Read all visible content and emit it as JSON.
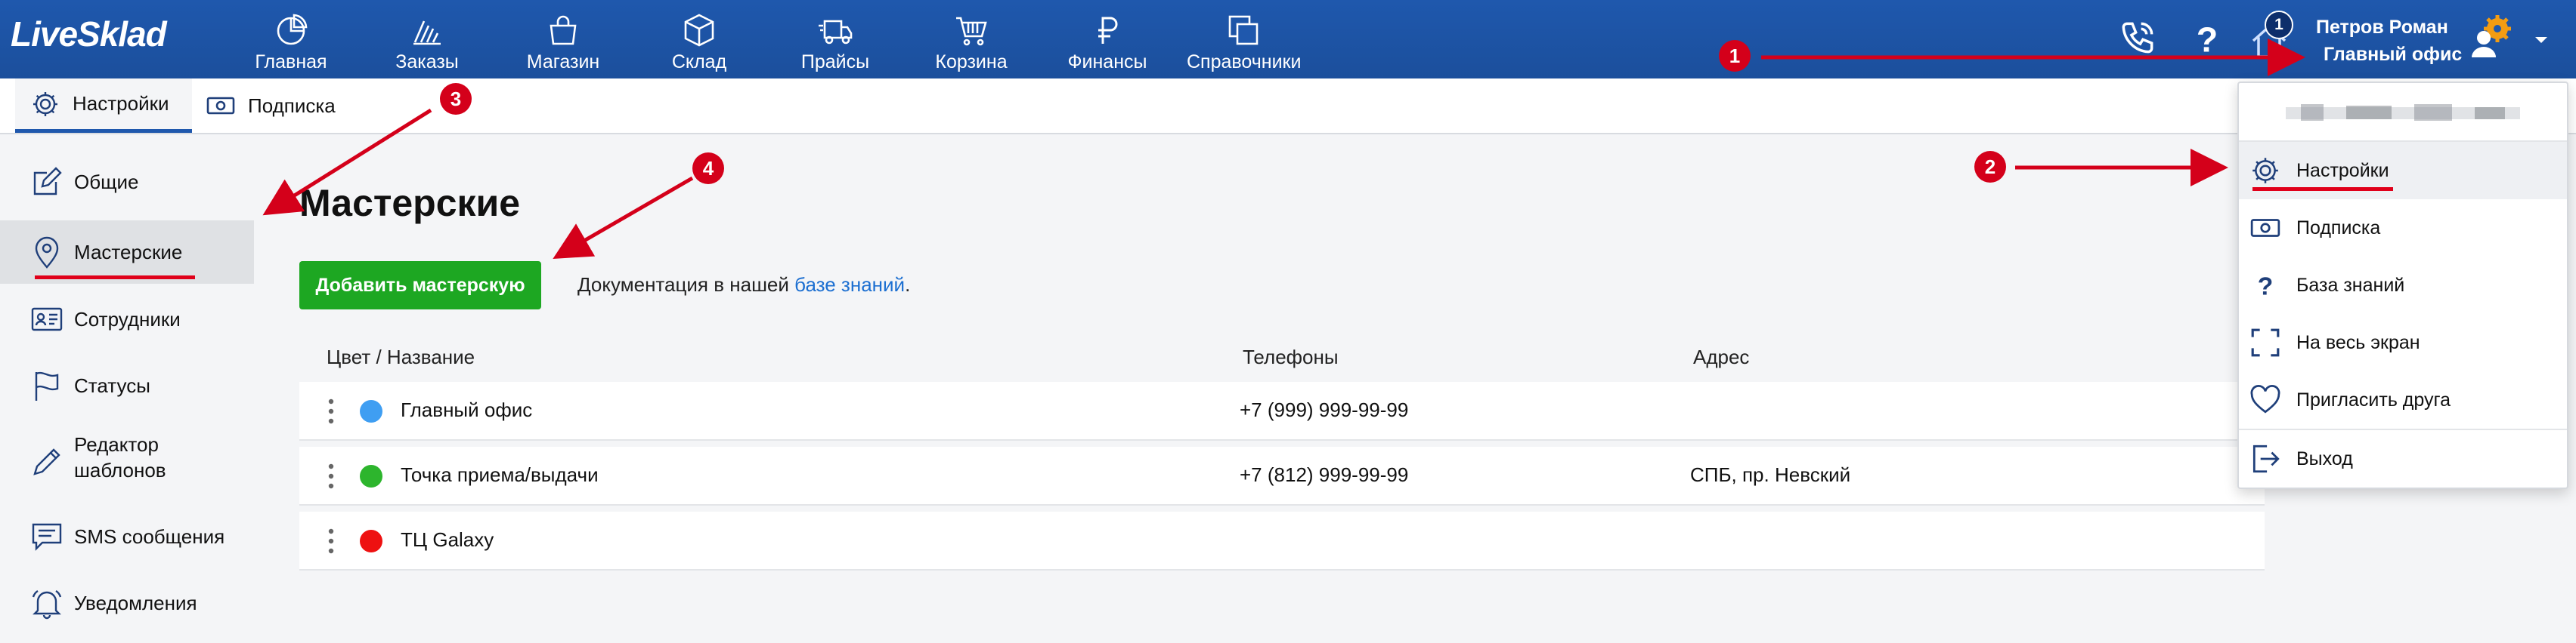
{
  "app": {
    "logo": "LiveSklad"
  },
  "nav": [
    {
      "label": "Главная",
      "icon": "chart-pie-icon"
    },
    {
      "label": "Заказы",
      "icon": "orders-icon"
    },
    {
      "label": "Магазин",
      "icon": "shopping-bag-icon"
    },
    {
      "label": "Склад",
      "icon": "box-icon"
    },
    {
      "label": "Прайсы",
      "icon": "truck-icon"
    },
    {
      "label": "Корзина",
      "icon": "cart-icon"
    },
    {
      "label": "Финансы",
      "icon": "ruble-icon"
    },
    {
      "label": "Справочники",
      "icon": "copy-icon"
    }
  ],
  "header": {
    "notification_count": "1",
    "user_name": "Петров Роман",
    "user_office": "Главный офис"
  },
  "subtabs": [
    {
      "label": "Настройки",
      "icon": "gear-icon",
      "active": true
    },
    {
      "label": "Подписка",
      "icon": "banknote-icon",
      "active": false
    }
  ],
  "sidebar": {
    "items": [
      {
        "label": "Общие",
        "icon": "edit-icon"
      },
      {
        "label": "Мастерские",
        "icon": "location-pin-icon",
        "active": true
      },
      {
        "label": "Сотрудники",
        "icon": "id-card-icon"
      },
      {
        "label": "Статусы",
        "icon": "flag-icon"
      },
      {
        "label": "Редактор шаблонов",
        "line1": "Редактор",
        "line2": "шаблонов",
        "icon": "pen-icon"
      },
      {
        "label": "SMS сообщения",
        "icon": "message-icon"
      },
      {
        "label": "Уведомления",
        "icon": "bell-icon"
      }
    ]
  },
  "main": {
    "title": "Мастерские",
    "add_button": "Добавить мастерскую",
    "doc_prefix": "Документация в нашей ",
    "doc_link": "базе знаний",
    "doc_suffix": ".",
    "columns": {
      "name": "Цвет / Название",
      "phones": "Телефоны",
      "address": "Адрес"
    },
    "rows": [
      {
        "color": "#3f9ef2",
        "name": "Главный офис",
        "phone": "+7 (999) 999-99-99",
        "address": ""
      },
      {
        "color": "#2db52d",
        "name": "Точка приема/выдачи",
        "phone": "+7 (812) 999-99-99",
        "address": "СПБ, пр. Невский"
      },
      {
        "color": "#ee1111",
        "name": "ТЦ Galaxy",
        "phone": "",
        "address": ""
      }
    ]
  },
  "dropdown": {
    "items": [
      {
        "label": "Настройки",
        "icon": "gear-icon",
        "active": true
      },
      {
        "label": "Подписка",
        "icon": "banknote-icon"
      },
      {
        "label": "База знаний",
        "icon": "question-icon"
      },
      {
        "label": "На весь экран",
        "icon": "fullscreen-icon"
      },
      {
        "label": "Пригласить друга",
        "icon": "heart-icon"
      },
      {
        "label": "Выход",
        "icon": "logout-icon"
      }
    ]
  },
  "callouts": [
    "1",
    "2",
    "3",
    "4"
  ],
  "colors": {
    "topbar": "#1f58ad",
    "accent_green": "#1da722",
    "annotation_red": "#d4001a",
    "link": "#1c6fd1"
  }
}
